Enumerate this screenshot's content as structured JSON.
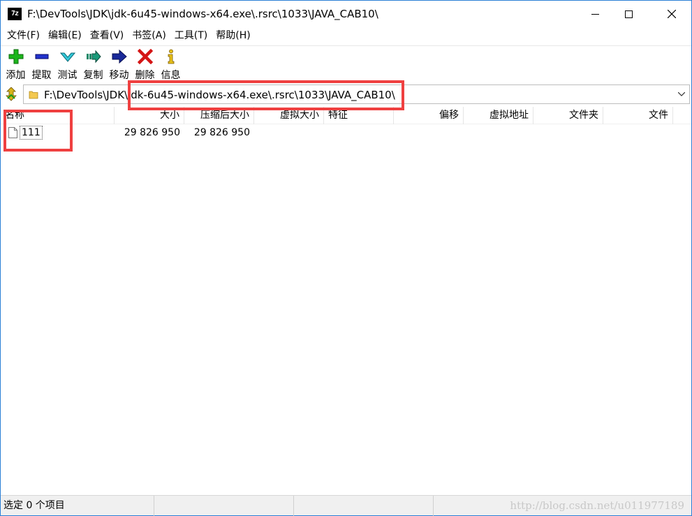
{
  "window": {
    "title": "F:\\DevTools\\JDK\\jdk-6u45-windows-x64.exe\\.rsrc\\1033\\JAVA_CAB10\\",
    "app_icon_text": "7z"
  },
  "menu": [
    "文件(F)",
    "编辑(E)",
    "查看(V)",
    "书签(A)",
    "工具(T)",
    "帮助(H)"
  ],
  "toolbar": [
    {
      "label": "添加",
      "icon": "add-icon"
    },
    {
      "label": "提取",
      "icon": "extract-icon"
    },
    {
      "label": "测试",
      "icon": "test-icon"
    },
    {
      "label": "复制",
      "icon": "copy-icon"
    },
    {
      "label": "移动",
      "icon": "move-icon"
    },
    {
      "label": "删除",
      "icon": "delete-icon"
    },
    {
      "label": "信息",
      "icon": "info-icon"
    }
  ],
  "address": {
    "path": "F:\\DevTools\\JDK\\jdk-6u45-windows-x64.exe\\.rsrc\\1033\\JAVA_CAB10\\"
  },
  "columns": [
    "名称",
    "大小",
    "压缩后大小",
    "虚拟大小",
    "特征",
    "偏移",
    "虚拟地址",
    "文件夹",
    "文件"
  ],
  "rows": [
    {
      "name": "111",
      "size": "29 826 950",
      "packed_size": "29 826 950"
    }
  ],
  "status": {
    "selected": "选定 0 个项目",
    "watermark": "http://blog.csdn.net/u011977189"
  },
  "colors": {
    "annotation": "#ef4040",
    "window_border": "#2b7fd6"
  }
}
